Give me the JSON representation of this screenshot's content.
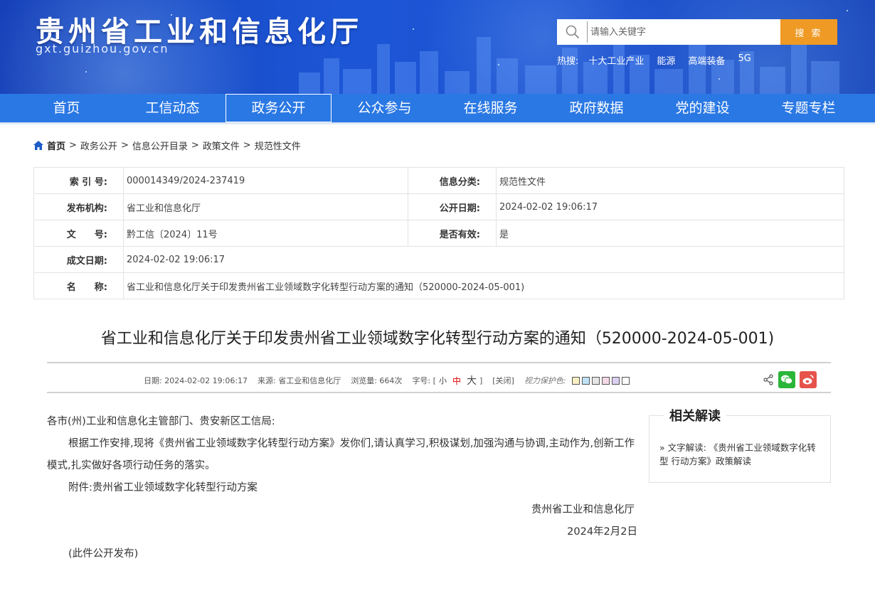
{
  "header": {
    "title": "贵州省工业和信息化厅",
    "domain": "gxt.guizhou.gov.cn",
    "search_placeholder": "请输入关键字",
    "search_button": "搜 索",
    "hot_label": "热搜:",
    "hot_items": [
      "十大工业产业",
      "能源",
      "高端装备",
      "5G"
    ]
  },
  "nav": {
    "items": [
      "首页",
      "工信动态",
      "政务公开",
      "公众参与",
      "在线服务",
      "政府数据",
      "党的建设",
      "专题专栏"
    ],
    "active_index": 2
  },
  "breadcrumb": {
    "items": [
      "首页",
      "政务公开",
      "信息公开目录",
      "政策文件",
      "规范性文件"
    ],
    "separator": ">"
  },
  "info": {
    "index_label": "索 引 号:",
    "index_value": "000014349/2024-237419",
    "category_label": "信息分类:",
    "category_value": "规范性文件",
    "publisher_label": "发布机构:",
    "publisher_value": "省工业和信息化厅",
    "public_date_label": "公开日期:",
    "public_date_value": "2024-02-02 19:06:17",
    "doc_no_label": "文　　号:",
    "doc_no_value": "黔工信〔2024〕11号",
    "valid_label": "是否有效:",
    "valid_value": "是",
    "written_date_label": "成文日期:",
    "written_date_value": "2024-02-02 19:06:17",
    "name_label": "名　　称:",
    "name_value": "省工业和信息化厅关于印发贵州省工业领域数字化转型行动方案的通知（520000-2024-05-001)"
  },
  "article": {
    "title": "省工业和信息化厅关于印发贵州省工业领域数字化转型行动方案的通知（520000-2024-05-001)",
    "meta": {
      "date": "日期: 2024-02-02 19:06:17",
      "source": "来源: 省工业和信息化厅",
      "views": "浏览量: 664次",
      "font_label": "字号: [",
      "font_small": "小",
      "font_mid": "中",
      "font_big": "大",
      "font_close": "]",
      "close": "[关闭]",
      "protect_label": "视力保护色:",
      "protect_colors": [
        "#f9efc4",
        "#bfe2f6",
        "#e6e6e6",
        "#f4d8e6",
        "#dcd0f0",
        "#ffffff"
      ]
    },
    "salutation": "各市(州)工业和信息化主管部门、贵安新区工信局:",
    "para1": "根据工作安排,现将《贵州省工业领域数字化转型行动方案》发你们,请认真学习,积极谋划,加强沟通与协调,主动作为,创新工作模式,扎实做好各项行动任务的落实。",
    "attachment": "附件:贵州省工业领域数字化转型行动方案",
    "signature_org": "贵州省工业和信息化厅",
    "signature_date": "2024年2月2日",
    "publish_note": "(此件公开发布)"
  },
  "related": {
    "title": "相关解读",
    "link": "» 文字解读: 《贵州省工业领域数字化转型 行动方案》政策解读"
  },
  "colors": {
    "header_blue": "#1c56d6",
    "nav_blue": "#2a78e4",
    "search_orange": "#ee9a24",
    "wechat_green": "#2bb63a",
    "weibo_red": "#e5534b"
  }
}
